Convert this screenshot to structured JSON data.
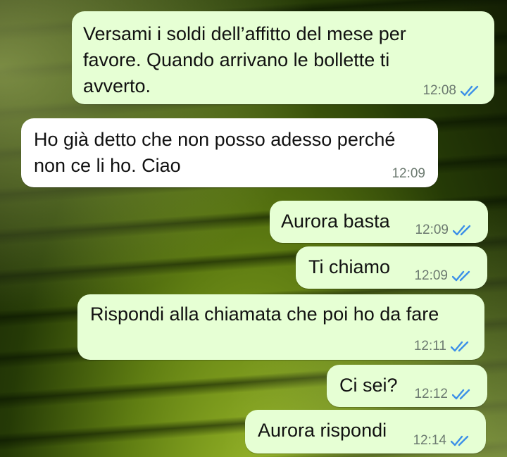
{
  "messages": [
    {
      "text": "Versami i soldi dell’affitto del mese per favore. Quando arrivano le bollette ti avverto.",
      "time": "12:08",
      "direction": "outgoing",
      "status": "read-double-check-icon"
    },
    {
      "text": "Ho già detto che non posso adesso perché non ce li ho. Ciao",
      "time": "12:09",
      "direction": "incoming"
    },
    {
      "text": "Aurora basta",
      "time": "12:09",
      "direction": "outgoing",
      "status": "read-double-check-icon"
    },
    {
      "text": "Ti chiamo",
      "time": "12:09",
      "direction": "outgoing",
      "status": "read-double-check-icon"
    },
    {
      "text": "Rispondi alla chiamata che poi ho da fare",
      "time": "12:11",
      "direction": "outgoing",
      "status": "read-double-check-icon"
    },
    {
      "text": "Ci sei?",
      "time": "12:12",
      "direction": "outgoing",
      "status": "read-double-check-icon"
    },
    {
      "text": "Aurora rispondi",
      "time": "12:14",
      "direction": "outgoing",
      "status": "read-double-check-icon"
    }
  ],
  "colors": {
    "outgoing_bubble": "#e6ffd4",
    "incoming_bubble": "#ffffff",
    "read_tick": "#3b8fe8",
    "timestamp": "#6c7a70"
  }
}
